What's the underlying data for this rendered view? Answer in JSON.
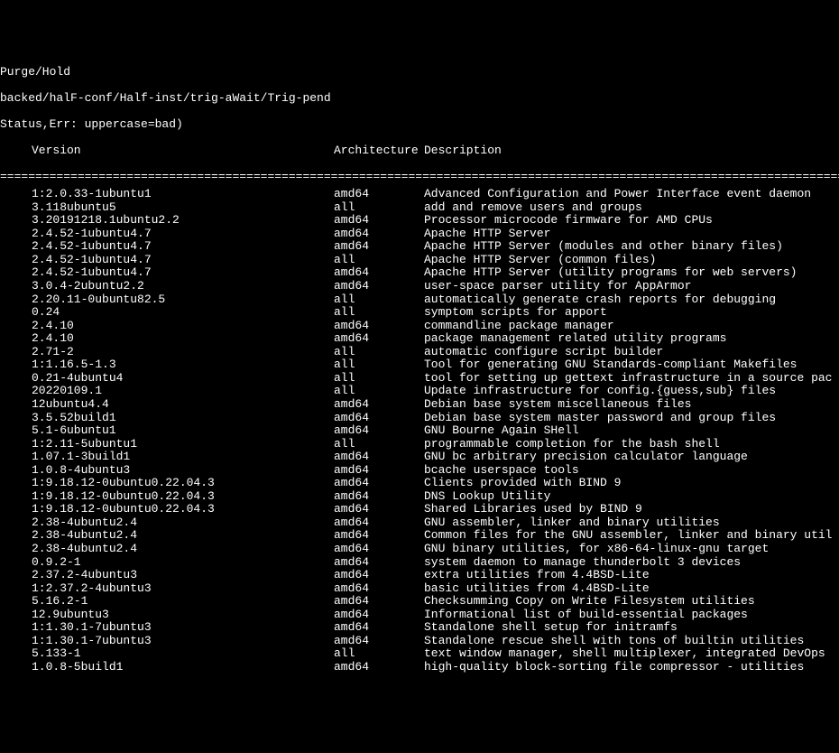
{
  "header": {
    "line1": "Purge/Hold",
    "line2": "backed/halF-conf/Half-inst/trig-aWait/Trig-pend",
    "line3": "Status,Err: uppercase=bad)",
    "col_version": "Version",
    "col_arch": "Architecture",
    "col_desc": "Description",
    "separator": "==============================================================================================================================="
  },
  "rows": [
    {
      "version": "1:2.0.33-1ubuntu1",
      "arch": "amd64",
      "desc": "Advanced Configuration and Power Interface event daemon"
    },
    {
      "version": "3.118ubuntu5",
      "arch": "all",
      "desc": "add and remove users and groups"
    },
    {
      "version": "3.20191218.1ubuntu2.2",
      "arch": "amd64",
      "desc": "Processor microcode firmware for AMD CPUs"
    },
    {
      "version": "2.4.52-1ubuntu4.7",
      "arch": "amd64",
      "desc": "Apache HTTP Server"
    },
    {
      "version": "2.4.52-1ubuntu4.7",
      "arch": "amd64",
      "desc": "Apache HTTP Server (modules and other binary files)"
    },
    {
      "version": "2.4.52-1ubuntu4.7",
      "arch": "all",
      "desc": "Apache HTTP Server (common files)"
    },
    {
      "version": "2.4.52-1ubuntu4.7",
      "arch": "amd64",
      "desc": "Apache HTTP Server (utility programs for web servers)"
    },
    {
      "version": "3.0.4-2ubuntu2.2",
      "arch": "amd64",
      "desc": "user-space parser utility for AppArmor"
    },
    {
      "version": "2.20.11-0ubuntu82.5",
      "arch": "all",
      "desc": "automatically generate crash reports for debugging"
    },
    {
      "version": "0.24",
      "arch": "all",
      "desc": "symptom scripts for apport"
    },
    {
      "version": "2.4.10",
      "arch": "amd64",
      "desc": "commandline package manager"
    },
    {
      "version": "2.4.10",
      "arch": "amd64",
      "desc": "package management related utility programs"
    },
    {
      "version": "2.71-2",
      "arch": "all",
      "desc": "automatic configure script builder"
    },
    {
      "version": "1:1.16.5-1.3",
      "arch": "all",
      "desc": "Tool for generating GNU Standards-compliant Makefiles"
    },
    {
      "version": "0.21-4ubuntu4",
      "arch": "all",
      "desc": "tool for setting up gettext infrastructure in a source pac"
    },
    {
      "version": "20220109.1",
      "arch": "all",
      "desc": "Update infrastructure for config.{guess,sub} files"
    },
    {
      "version": "12ubuntu4.4",
      "arch": "amd64",
      "desc": "Debian base system miscellaneous files"
    },
    {
      "version": "3.5.52build1",
      "arch": "amd64",
      "desc": "Debian base system master password and group files"
    },
    {
      "version": "5.1-6ubuntu1",
      "arch": "amd64",
      "desc": "GNU Bourne Again SHell"
    },
    {
      "version": "1:2.11-5ubuntu1",
      "arch": "all",
      "desc": "programmable completion for the bash shell"
    },
    {
      "version": "1.07.1-3build1",
      "arch": "amd64",
      "desc": "GNU bc arbitrary precision calculator language"
    },
    {
      "version": "1.0.8-4ubuntu3",
      "arch": "amd64",
      "desc": "bcache userspace tools"
    },
    {
      "version": "1:9.18.12-0ubuntu0.22.04.3",
      "arch": "amd64",
      "desc": "Clients provided with BIND 9"
    },
    {
      "version": "1:9.18.12-0ubuntu0.22.04.3",
      "arch": "amd64",
      "desc": "DNS Lookup Utility"
    },
    {
      "version": "1:9.18.12-0ubuntu0.22.04.3",
      "arch": "amd64",
      "desc": "Shared Libraries used by BIND 9"
    },
    {
      "version": "2.38-4ubuntu2.4",
      "arch": "amd64",
      "desc": "GNU assembler, linker and binary utilities"
    },
    {
      "version": "2.38-4ubuntu2.4",
      "arch": "amd64",
      "desc": "Common files for the GNU assembler, linker and binary util"
    },
    {
      "version": "2.38-4ubuntu2.4",
      "arch": "amd64",
      "desc": "GNU binary utilities, for x86-64-linux-gnu target"
    },
    {
      "version": "0.9.2-1",
      "arch": "amd64",
      "desc": "system daemon to manage thunderbolt 3 devices"
    },
    {
      "version": "2.37.2-4ubuntu3",
      "arch": "amd64",
      "desc": "extra utilities from 4.4BSD-Lite"
    },
    {
      "version": "1:2.37.2-4ubuntu3",
      "arch": "amd64",
      "desc": "basic utilities from 4.4BSD-Lite"
    },
    {
      "version": "5.16.2-1",
      "arch": "amd64",
      "desc": "Checksumming Copy on Write Filesystem utilities"
    },
    {
      "version": "12.9ubuntu3",
      "arch": "amd64",
      "desc": "Informational list of build-essential packages"
    },
    {
      "version": "1:1.30.1-7ubuntu3",
      "arch": "amd64",
      "desc": "Standalone shell setup for initramfs"
    },
    {
      "version": "1:1.30.1-7ubuntu3",
      "arch": "amd64",
      "desc": "Standalone rescue shell with tons of builtin utilities"
    },
    {
      "version": "5.133-1",
      "arch": "all",
      "desc": "text window manager, shell multiplexer, integrated DevOps "
    },
    {
      "version": "1.0.8-5build1",
      "arch": "amd64",
      "desc": "high-quality block-sorting file compressor - utilities"
    }
  ]
}
